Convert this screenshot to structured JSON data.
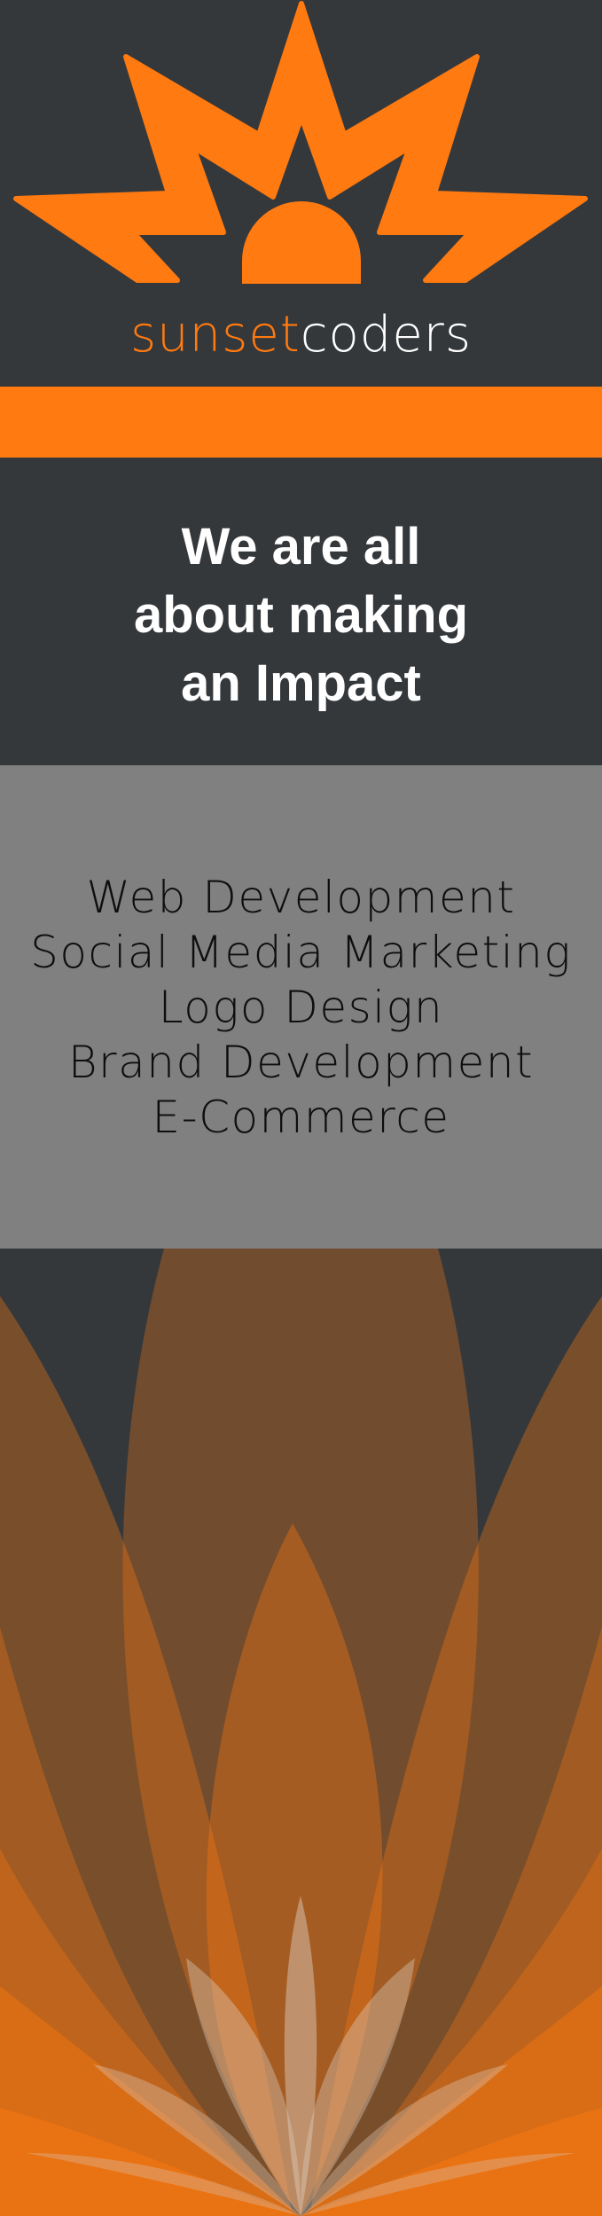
{
  "brand": {
    "name_part_1": "sunset",
    "name_part_2": "coders",
    "logo_icon": "sun-burst-icon",
    "colors": {
      "orange": "#ff7a10",
      "dark": "#35383b",
      "gray": "#808080",
      "white": "#ffffff"
    }
  },
  "tagline": {
    "lines": [
      "We are all",
      "about making",
      "an Impact"
    ]
  },
  "services": {
    "items": [
      "Web Development",
      "Social Media Marketing",
      "Logo Design",
      "Brand Development",
      "E-Commerce"
    ]
  },
  "decoration": {
    "icon": "lotus-petals-icon"
  }
}
